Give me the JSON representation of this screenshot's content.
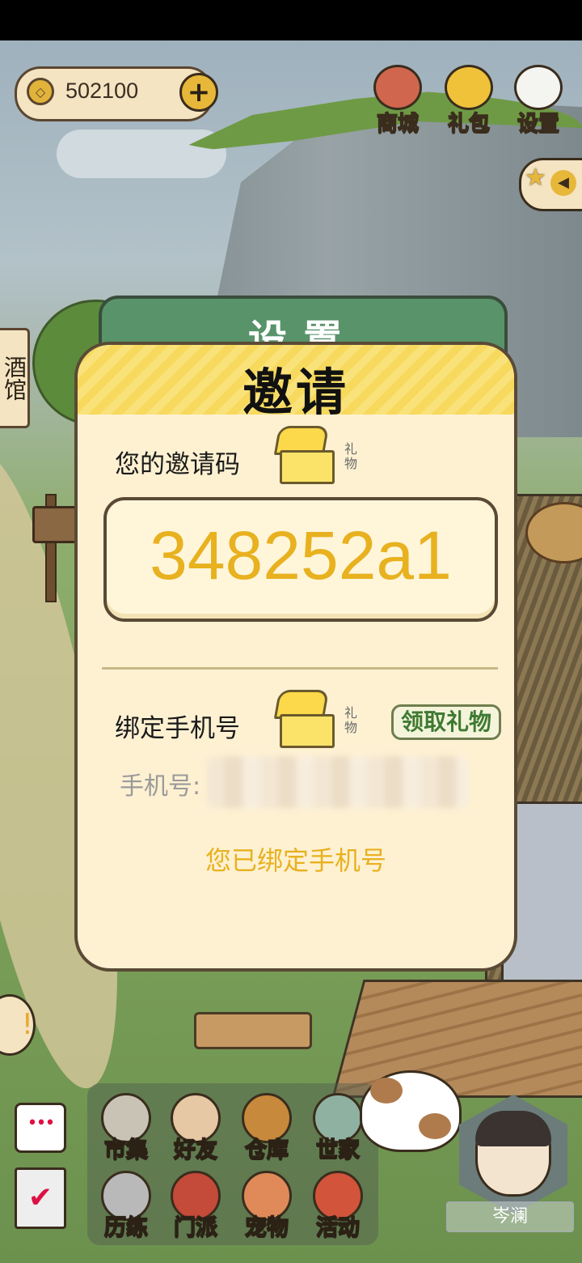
{
  "hud": {
    "currency_value": "502100",
    "currency_icon": "coin-icon",
    "add_icon": "+",
    "buttons": [
      {
        "label": "商城",
        "icon": "shop-bag-icon"
      },
      {
        "label": "礼包",
        "icon": "gift-ingot-icon"
      },
      {
        "label": "设置",
        "icon": "settings-gear-icon"
      }
    ],
    "star_icon": "★",
    "arrow_icon": "◀"
  },
  "side": {
    "tavern_label": "酒馆"
  },
  "settings_window": {
    "title": "设置"
  },
  "invite_dialog": {
    "title": "邀请",
    "invite_code_label": "您的邀请码",
    "gift_label": "礼物",
    "invite_code": "348252a1",
    "bind_phone_label": "绑定手机号",
    "claim_button": "领取礼物",
    "phone_label": "手机号:",
    "bound_message": "您已绑定手机号"
  },
  "bottom_nav": {
    "row1": [
      {
        "label": "市集",
        "color": "#c9c3b6"
      },
      {
        "label": "好友",
        "color": "#e6c8a4"
      },
      {
        "label": "仓库",
        "color": "#c7893c"
      },
      {
        "label": "世家",
        "color": "#8fb1a2"
      }
    ],
    "row2": [
      {
        "label": "历练",
        "color": "#b9b9b9"
      },
      {
        "label": "门派",
        "color": "#c44a3a"
      },
      {
        "label": "宠物",
        "color": "#e08a5a"
      },
      {
        "label": "活动",
        "color": "#d2543a"
      }
    ],
    "chat_icon": "•••",
    "task_icon": "✔"
  },
  "avatar": {
    "name": "岑澜"
  },
  "colors": {
    "accent_gold": "#e8b11f",
    "claim_green": "#3f7a33",
    "dialog_bg": "#fef1d2",
    "settings_green": "#58936a"
  }
}
